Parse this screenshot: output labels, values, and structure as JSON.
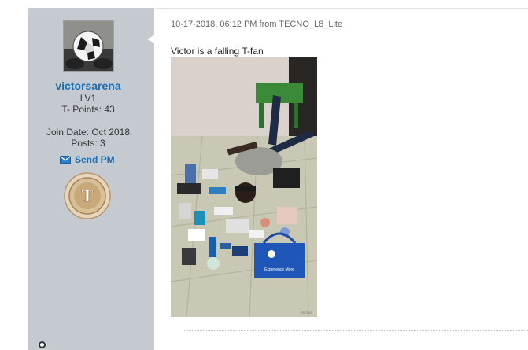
{
  "user": {
    "username": "victorsarena",
    "level": "LV1",
    "points": "T- Points: 43",
    "join_date": "Join Date: Oct 2018",
    "posts": "Posts: 3",
    "send_pm_label": "Send PM",
    "badge_letter": "T",
    "avatar_icon": "soccer-ball-avatar",
    "mail_icon": "envelope-icon"
  },
  "post": {
    "meta": "10-17-2018, 06:12 PM from TECNO_L8_Lite",
    "text": "Victor is a falling T-fan",
    "photo_bag_label": "Experience More",
    "photo_watermark": "TECNO"
  },
  "colors": {
    "sidebar_bg": "#c5cad0",
    "link_blue": "#1a6fb3",
    "badge_gold": "#c9a97a"
  }
}
